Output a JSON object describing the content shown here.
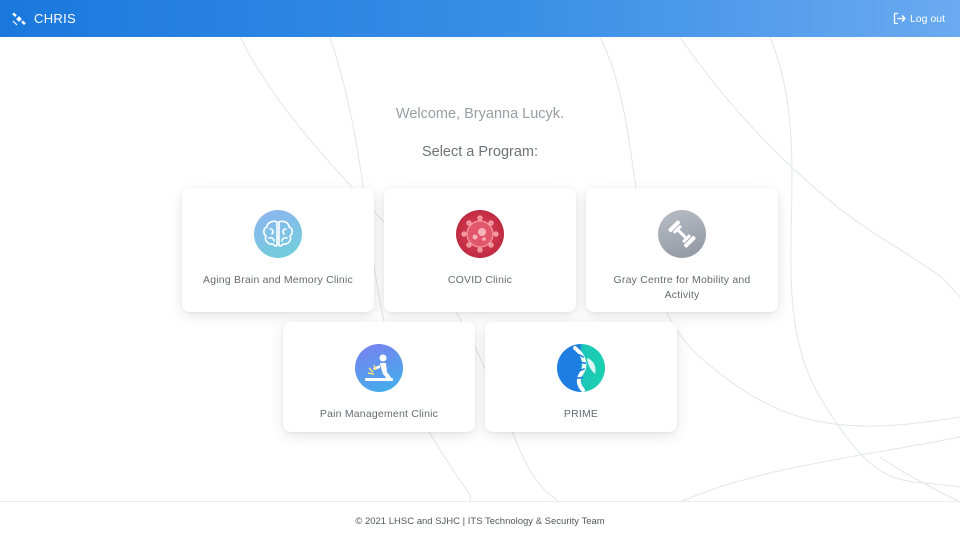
{
  "header": {
    "app_name": "CHRIS",
    "brand_icon": "satellite-icon",
    "logout_label": "Log out",
    "logout_icon": "logout-icon",
    "gradient_colors": [
      "#1a78dd",
      "#6aaaf0"
    ]
  },
  "main": {
    "welcome": "Welcome, Bryanna Lucyk.",
    "select_title": "Select a Program:",
    "programs": [
      {
        "label": "Aging Brain and Memory Clinic",
        "icon": "brain-icon"
      },
      {
        "label": "COVID Clinic",
        "icon": "virus-icon"
      },
      {
        "label": "Gray Centre for Mobility and Activity",
        "icon": "dumbbell-icon"
      },
      {
        "label": "Pain Management Clinic",
        "icon": "back-pain-icon"
      },
      {
        "label": "PRIME",
        "icon": "spine-icon"
      }
    ]
  },
  "footer": {
    "text": "© 2021 LHSC and SJHC | ITS Technology & Security Team"
  }
}
